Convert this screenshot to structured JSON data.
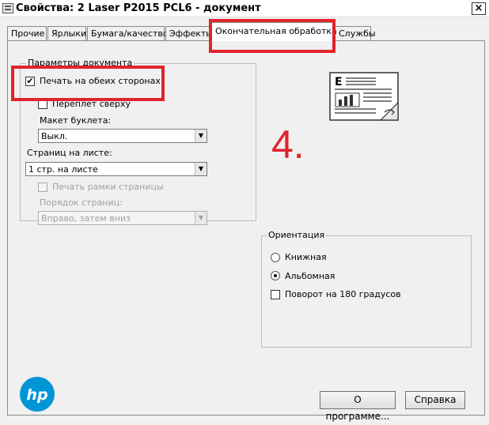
{
  "window": {
    "title": "Свойства: 2 Laser P2015 PCL6 - документ",
    "close_glyph": "×"
  },
  "tabs": [
    {
      "label": "Прочие"
    },
    {
      "label": "Ярлыки"
    },
    {
      "label": "Бумага/качество"
    },
    {
      "label": "Эффекты"
    },
    {
      "label": "Окончательная обработка",
      "active": true
    },
    {
      "label": "Службы"
    }
  ],
  "document_options": {
    "legend": "Параметры документа",
    "duplex": {
      "label": "Печать на обеих сторонах",
      "checked": true,
      "check_glyph": "✔"
    },
    "flip_pages_up": {
      "label": "Переплет сверху",
      "checked": false
    },
    "booklet_layout": {
      "label": "Макет буклета:",
      "value": "Выкл."
    },
    "pages_per_sheet": {
      "label": "Страниц на листе:",
      "value": "1 стр. на листе"
    },
    "print_page_borders": {
      "label": "Печать рамки страницы",
      "checked": false,
      "disabled": true
    },
    "page_order": {
      "label": "Порядок страниц:",
      "value": "Вправо, затем вниз",
      "disabled": true
    },
    "dropdown_glyph": "▼"
  },
  "annotation": {
    "text": "4."
  },
  "preview": {
    "icon": "duplex-document-preview-icon",
    "letter": "E"
  },
  "orientation": {
    "legend": "Ориентация",
    "portrait": {
      "label": "Книжная",
      "selected": false
    },
    "landscape": {
      "label": "Альбомная",
      "selected": true
    },
    "rotate_180": {
      "label": "Поворот на 180 градусов",
      "checked": false
    }
  },
  "logo": {
    "text": "hp"
  },
  "buttons": {
    "about": "О программе...",
    "help": "Справка"
  },
  "colors": {
    "highlight_red": "#e0242b",
    "hp_blue": "#0096d6"
  }
}
